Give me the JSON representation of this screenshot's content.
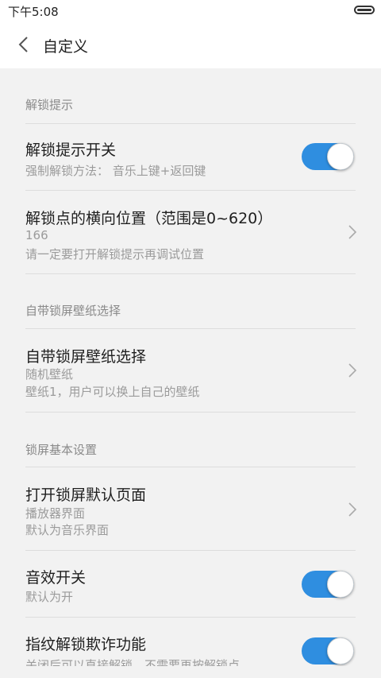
{
  "status": {
    "time": "下午5:08"
  },
  "header": {
    "title": "自定义"
  },
  "sections": {
    "unlock_hint": {
      "title": "解锁提示",
      "toggle_row": {
        "title": "解锁提示开关",
        "sub": "强制解锁方法：  音乐上键+返回键",
        "on": true
      },
      "position_row": {
        "title": "解锁点的横向位置（范围是0~620）",
        "value": "166",
        "sub": "请一定要打开解锁提示再调试位置"
      }
    },
    "wallpaper": {
      "title": "自带锁屏壁纸选择",
      "row": {
        "title": "自带锁屏壁纸选择",
        "value": "随机壁纸",
        "sub": "壁纸1，用户可以换上自己的壁纸"
      }
    },
    "basic": {
      "title": "锁屏基本设置",
      "default_page_row": {
        "title": "打开锁屏默认页面",
        "value": "播放器界面",
        "sub": "默认为音乐界面"
      },
      "sound_row": {
        "title": "音效开关",
        "sub": "默认为开",
        "on": true
      },
      "fingerprint_row": {
        "title": "指纹解锁欺诈功能",
        "sub": "关闭后可以直接解锁，不需要再按解锁点",
        "on": true
      }
    }
  },
  "colors": {
    "accent": "#2f8ee0",
    "background": "#f2f2f2"
  },
  "icons": {
    "back": "chevron-left-icon",
    "chevron": "chevron-right-icon",
    "battery": "battery-icon"
  }
}
